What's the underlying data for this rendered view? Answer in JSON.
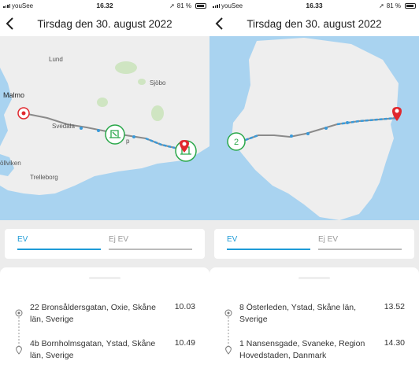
{
  "screens": [
    {
      "status": {
        "carrier": "youSee",
        "time": "16.32",
        "battery": "81 %"
      },
      "header": {
        "title": "Tirsdag den 30. august 2022"
      },
      "map": {
        "labels": [
          "Lund",
          "Sjöbo",
          "Malmo",
          "Svedala",
          "öllviken",
          "Trelleborg",
          "p"
        ]
      },
      "tabs": [
        {
          "label": "EV",
          "active": true
        },
        {
          "label": "Ej EV",
          "active": false
        }
      ],
      "trip": {
        "start": {
          "address": "22 Bronsåldersgatan, Oxie, Skåne län, Sverige",
          "time": "10.03"
        },
        "end": {
          "address": "4b Bornholmsgatan, Ystad, Skåne län, Sverige",
          "time": "10.49"
        }
      }
    },
    {
      "status": {
        "carrier": "youSee",
        "time": "16.33",
        "battery": "81 %"
      },
      "header": {
        "title": "Tirsdag den 30. august 2022"
      },
      "map": {
        "cluster_count": "2"
      },
      "tabs": [
        {
          "label": "EV",
          "active": true
        },
        {
          "label": "Ej EV",
          "active": false
        }
      ],
      "trip": {
        "start": {
          "address": "8 Österleden, Ystad, Skåne län, Sverige",
          "time": "13.52"
        },
        "end": {
          "address": "1 Nansensgade, Svaneke, Region Hovedstaden, Danmark",
          "time": "14.30"
        }
      }
    }
  ],
  "colors": {
    "accent": "#1e9bd7",
    "pin": "#e0282e",
    "ev_icon": "#2aa84a",
    "route_gray": "#8a8a8a",
    "water": "#a9d3f0",
    "land": "#eeeeee"
  }
}
